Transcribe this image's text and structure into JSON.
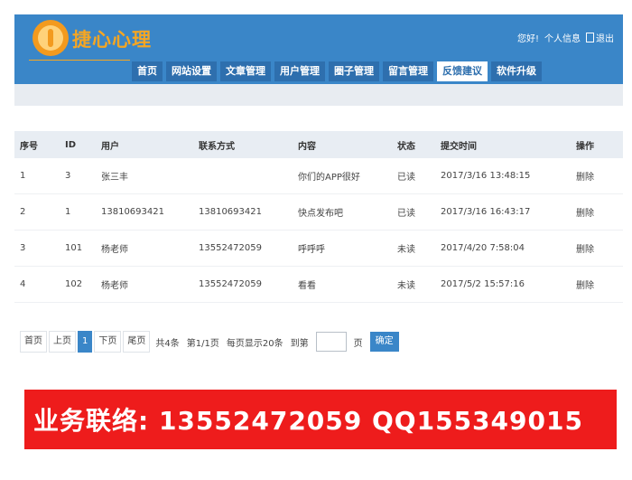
{
  "header": {
    "brand": "捷心心理",
    "nav": [
      {
        "label": "首页",
        "active": false
      },
      {
        "label": "网站设置",
        "active": false
      },
      {
        "label": "文章管理",
        "active": false
      },
      {
        "label": "用户管理",
        "active": false
      },
      {
        "label": "圈子管理",
        "active": false
      },
      {
        "label": "留言管理",
        "active": false
      },
      {
        "label": "反馈建议",
        "active": true
      },
      {
        "label": "软件升级",
        "active": false
      }
    ],
    "greeting": "您好!",
    "profile": "个人信息",
    "logout": "退出"
  },
  "table": {
    "headers": [
      "序号",
      "ID",
      "用户",
      "联系方式",
      "内容",
      "状态",
      "提交时间",
      "操作"
    ],
    "rows": [
      {
        "idx": "1",
        "id": "3",
        "user": "张三丰",
        "contact": "",
        "content": "你们的APP很好",
        "status": "已读",
        "time": "2017/3/16 13:48:15",
        "op": "删除"
      },
      {
        "idx": "2",
        "id": "1",
        "user": "13810693421",
        "contact": "13810693421",
        "content": "快点发布吧",
        "status": "已读",
        "time": "2017/3/16 16:43:17",
        "op": "删除"
      },
      {
        "idx": "3",
        "id": "101",
        "user": "杨老师",
        "contact": "13552472059",
        "content": "呼呼呼",
        "status": "未读",
        "time": "2017/4/20 7:58:04",
        "op": "删除"
      },
      {
        "idx": "4",
        "id": "102",
        "user": "杨老师",
        "contact": "13552472059",
        "content": "看看",
        "status": "未读",
        "time": "2017/5/2 15:57:16",
        "op": "删除"
      }
    ]
  },
  "pager": {
    "first": "首页",
    "prev": "上页",
    "current": "1",
    "next": "下页",
    "last": "尾页",
    "total": "共4条",
    "page_of": "第1/1页",
    "per_page": "每页显示20条",
    "goto": "到第",
    "page_unit": "页",
    "confirm": "确定"
  },
  "banner": {
    "text": "业务联络: 13552472059 QQ155349015"
  },
  "colors": {
    "header_bg": "#3a86c8",
    "brand": "#f5a623",
    "banner_bg": "#ee1c1c"
  }
}
